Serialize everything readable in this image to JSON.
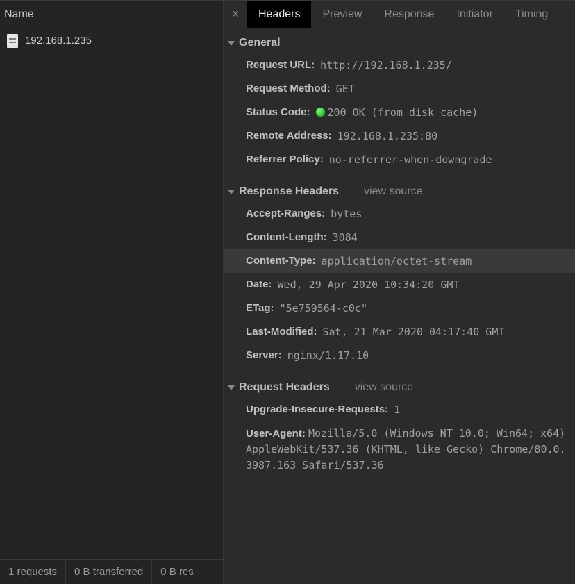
{
  "left": {
    "header": "Name",
    "requests": [
      {
        "name": "192.168.1.235"
      }
    ],
    "footer": {
      "count": "1 requests",
      "transferred": "0 B transferred",
      "resources": "0 B res"
    }
  },
  "tabs": {
    "items": [
      "Headers",
      "Preview",
      "Response",
      "Initiator",
      "Timing"
    ],
    "active": 0
  },
  "sections": {
    "general": {
      "title": "General",
      "request_url_k": "Request URL:",
      "request_url_v": "http://192.168.1.235/",
      "request_method_k": "Request Method:",
      "request_method_v": "GET",
      "status_code_k": "Status Code:",
      "status_code_v": "200 OK (from disk cache)",
      "remote_addr_k": "Remote Address:",
      "remote_addr_v": "192.168.1.235:80",
      "referrer_policy_k": "Referrer Policy:",
      "referrer_policy_v": "no-referrer-when-downgrade"
    },
    "response": {
      "title": "Response Headers",
      "view_source": "view source",
      "accept_ranges_k": "Accept-Ranges:",
      "accept_ranges_v": "bytes",
      "content_length_k": "Content-Length:",
      "content_length_v": "3084",
      "content_type_k": "Content-Type:",
      "content_type_v": "application/octet-stream",
      "date_k": "Date:",
      "date_v": "Wed, 29 Apr 2020 10:34:20 GMT",
      "etag_k": "ETag:",
      "etag_v": "\"5e759564-c0c\"",
      "last_modified_k": "Last-Modified:",
      "last_modified_v": "Sat, 21 Mar 2020 04:17:40 GMT",
      "server_k": "Server:",
      "server_v": "nginx/1.17.10"
    },
    "request": {
      "title": "Request Headers",
      "view_source": "view source",
      "upgrade_k": "Upgrade-Insecure-Requests:",
      "upgrade_v": "1",
      "ua_k": "User-Agent:",
      "ua_v": "Mozilla/5.0 (Windows NT 10.0; Win64; x64) AppleWebKit/537.36 (KHTML, like Gecko) Chrome/80.0.3987.163 Safari/537.36"
    }
  }
}
